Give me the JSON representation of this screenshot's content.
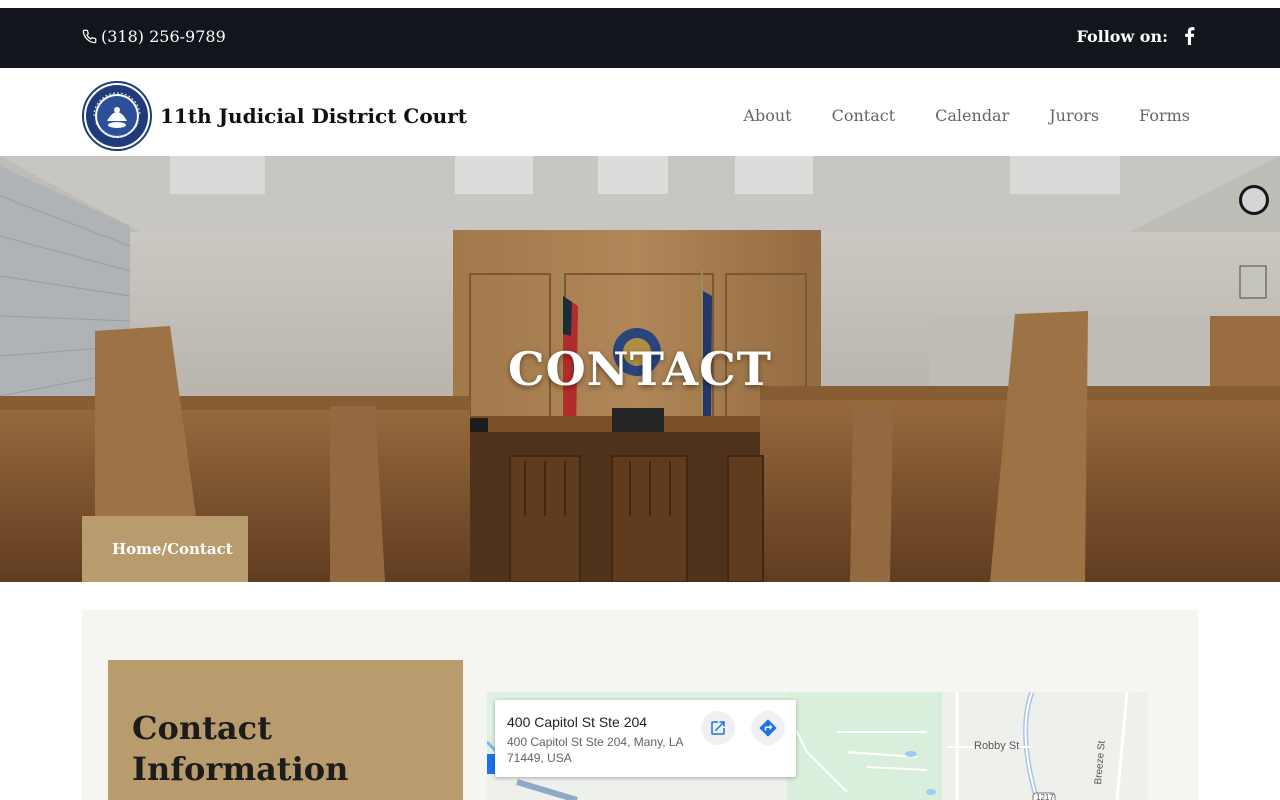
{
  "topbar": {
    "phone": "(318) 256-9789",
    "follow_label": "Follow on:",
    "phone_icon": "phone-icon",
    "social_icon": "facebook-icon"
  },
  "header": {
    "site_title": "11th Judicial District Court",
    "logo": "court-seal-logo",
    "nav": [
      "About",
      "Contact",
      "Calendar",
      "Jurors",
      "Forms"
    ]
  },
  "hero": {
    "title": "CONTACT",
    "breadcrumb_home": "Home",
    "breadcrumb_sep": "/",
    "breadcrumb_current": "Contact"
  },
  "contact": {
    "heading": "Contact Information"
  },
  "map": {
    "place_title": "400 Capitol St Ste 204",
    "place_address": "400 Capitol St Ste 204, Many, LA 71449, USA",
    "street_label_1": "Robby St",
    "street_label_2": "Breeze St",
    "route_shield": "1217",
    "open_icon": "open-in-new-icon",
    "directions_icon": "directions-icon"
  },
  "colors": {
    "topbar_bg": "#12151c",
    "accent_tan": "#b89c6e",
    "content_bg": "#f6f5f1"
  }
}
